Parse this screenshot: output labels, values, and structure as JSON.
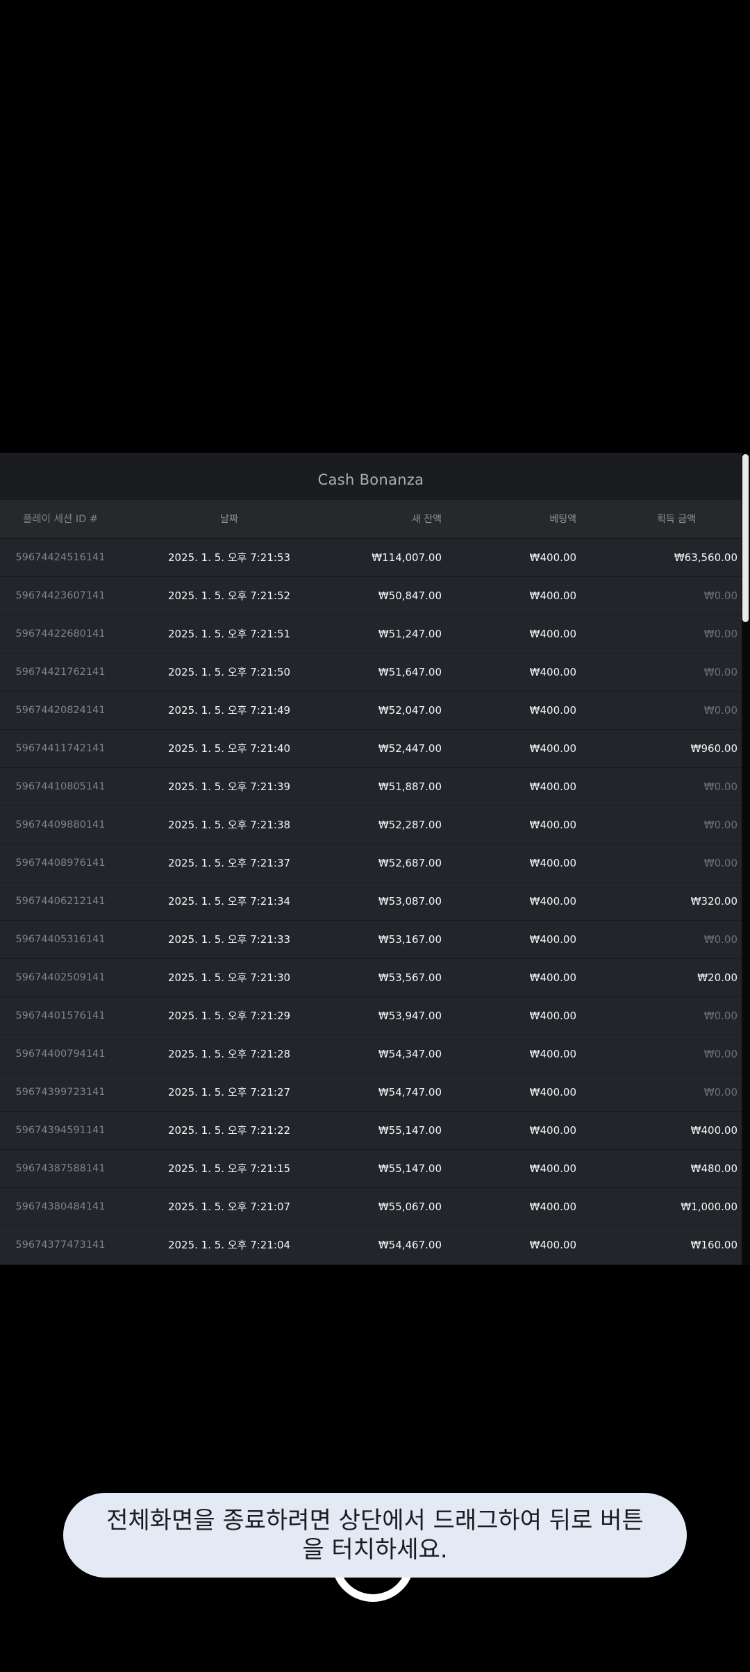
{
  "panel": {
    "title": "Cash Bonanza"
  },
  "table": {
    "headers": {
      "id": "플레이 세션 ID #",
      "date": "날짜",
      "balance": "새 잔액",
      "bet": "베팅액",
      "win": "획득 금액"
    },
    "rows": [
      {
        "id": "59674424516141",
        "date": "2025. 1. 5. 오후 7:21:53",
        "balance": "₩114,007.00",
        "bet": "₩400.00",
        "win": "₩63,560.00"
      },
      {
        "id": "59674423607141",
        "date": "2025. 1. 5. 오후 7:21:52",
        "balance": "₩50,847.00",
        "bet": "₩400.00",
        "win": "₩0.00"
      },
      {
        "id": "59674422680141",
        "date": "2025. 1. 5. 오후 7:21:51",
        "balance": "₩51,247.00",
        "bet": "₩400.00",
        "win": "₩0.00"
      },
      {
        "id": "59674421762141",
        "date": "2025. 1. 5. 오후 7:21:50",
        "balance": "₩51,647.00",
        "bet": "₩400.00",
        "win": "₩0.00"
      },
      {
        "id": "59674420824141",
        "date": "2025. 1. 5. 오후 7:21:49",
        "balance": "₩52,047.00",
        "bet": "₩400.00",
        "win": "₩0.00"
      },
      {
        "id": "59674411742141",
        "date": "2025. 1. 5. 오후 7:21:40",
        "balance": "₩52,447.00",
        "bet": "₩400.00",
        "win": "₩960.00"
      },
      {
        "id": "59674410805141",
        "date": "2025. 1. 5. 오후 7:21:39",
        "balance": "₩51,887.00",
        "bet": "₩400.00",
        "win": "₩0.00"
      },
      {
        "id": "59674409880141",
        "date": "2025. 1. 5. 오후 7:21:38",
        "balance": "₩52,287.00",
        "bet": "₩400.00",
        "win": "₩0.00"
      },
      {
        "id": "59674408976141",
        "date": "2025. 1. 5. 오후 7:21:37",
        "balance": "₩52,687.00",
        "bet": "₩400.00",
        "win": "₩0.00"
      },
      {
        "id": "59674406212141",
        "date": "2025. 1. 5. 오후 7:21:34",
        "balance": "₩53,087.00",
        "bet": "₩400.00",
        "win": "₩320.00"
      },
      {
        "id": "59674405316141",
        "date": "2025. 1. 5. 오후 7:21:33",
        "balance": "₩53,167.00",
        "bet": "₩400.00",
        "win": "₩0.00"
      },
      {
        "id": "59674402509141",
        "date": "2025. 1. 5. 오후 7:21:30",
        "balance": "₩53,567.00",
        "bet": "₩400.00",
        "win": "₩20.00"
      },
      {
        "id": "59674401576141",
        "date": "2025. 1. 5. 오후 7:21:29",
        "balance": "₩53,947.00",
        "bet": "₩400.00",
        "win": "₩0.00"
      },
      {
        "id": "59674400794141",
        "date": "2025. 1. 5. 오후 7:21:28",
        "balance": "₩54,347.00",
        "bet": "₩400.00",
        "win": "₩0.00"
      },
      {
        "id": "59674399723141",
        "date": "2025. 1. 5. 오후 7:21:27",
        "balance": "₩54,747.00",
        "bet": "₩400.00",
        "win": "₩0.00"
      },
      {
        "id": "59674394591141",
        "date": "2025. 1. 5. 오후 7:21:22",
        "balance": "₩55,147.00",
        "bet": "₩400.00",
        "win": "₩400.00"
      },
      {
        "id": "59674387588141",
        "date": "2025. 1. 5. 오후 7:21:15",
        "balance": "₩55,147.00",
        "bet": "₩400.00",
        "win": "₩480.00"
      },
      {
        "id": "59674380484141",
        "date": "2025. 1. 5. 오후 7:21:07",
        "balance": "₩55,067.00",
        "bet": "₩400.00",
        "win": "₩1,000.00"
      },
      {
        "id": "59674377473141",
        "date": "2025. 1. 5. 오후 7:21:04",
        "balance": "₩54,467.00",
        "bet": "₩400.00",
        "win": "₩160.00"
      }
    ]
  },
  "toast": {
    "message": "전체화면을 종료하려면 상단에서 드래그하여 뒤로 버튼을 터치하세요."
  },
  "colors": {
    "background": "#000000",
    "panel": "#1c2022",
    "row": "#22262a",
    "text_primary": "#f4f5f6",
    "text_muted": "#6c7176",
    "toast_bg": "#e4e9f6"
  }
}
